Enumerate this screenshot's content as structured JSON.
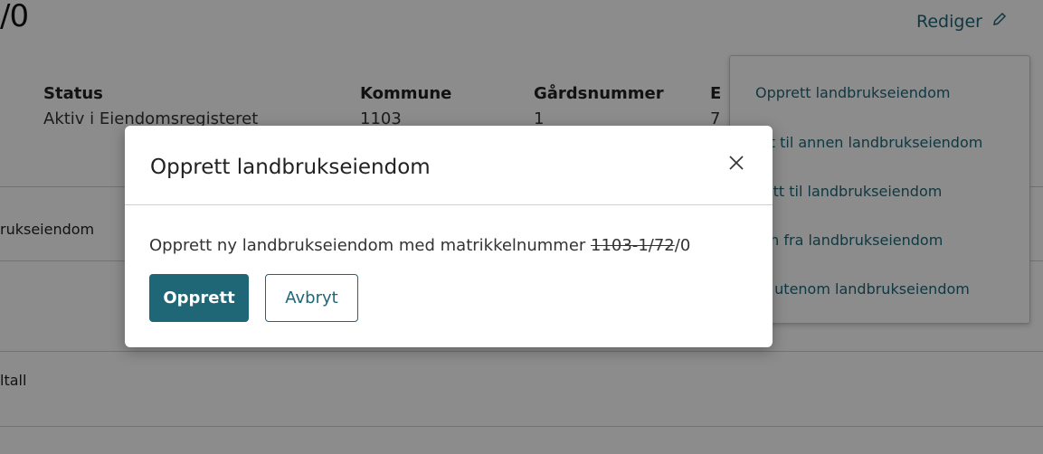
{
  "page": {
    "title_fragment": "/0",
    "edit_label": "Rediger"
  },
  "details": {
    "status_label": "Status",
    "status_value": "Aktiv i Eiendomsregisteret",
    "kommune_label": "Kommune",
    "kommune_value": "1103",
    "gardsnummer_label": "Gårdsnummer",
    "gardsnummer_value": "1",
    "truncated_label": "E",
    "truncated_value": "7"
  },
  "rows": {
    "row1": "rukseiendom",
    "row2": "ltall"
  },
  "menu": {
    "items": [
      "Opprett landbrukseiendom",
      "ytt til annen landbrukseiendom",
      "nytt til landbrukseiendom",
      "ern fra landbrukseiendom",
      "ift utenom landbrukseiendom"
    ]
  },
  "modal": {
    "title": "Opprett landbrukseiendom",
    "text_prefix": "Opprett ny landbrukseiendom med matrikkelnummer ",
    "text_strike": "1103-1/72",
    "text_suffix": "/0",
    "confirm_label": "Opprett",
    "cancel_label": "Avbryt"
  },
  "colors": {
    "accent": "#1f6677",
    "overlay": "rgba(0,0,0,0.45)"
  }
}
